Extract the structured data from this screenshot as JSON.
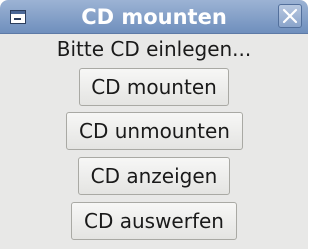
{
  "window": {
    "title": "CD mounten"
  },
  "icons": {
    "window_icon": "window-icon",
    "close": "close-icon"
  },
  "colors": {
    "titlebar_top": "#9cb3d4",
    "titlebar_bottom": "#6f8fbd",
    "window_bg": "#e8e8e7"
  },
  "content": {
    "prompt": "Bitte CD einlegen..."
  },
  "buttons": {
    "mount": "CD mounten",
    "unmount": "CD unmounten",
    "show": "CD anzeigen",
    "eject": "CD auswerfen"
  }
}
